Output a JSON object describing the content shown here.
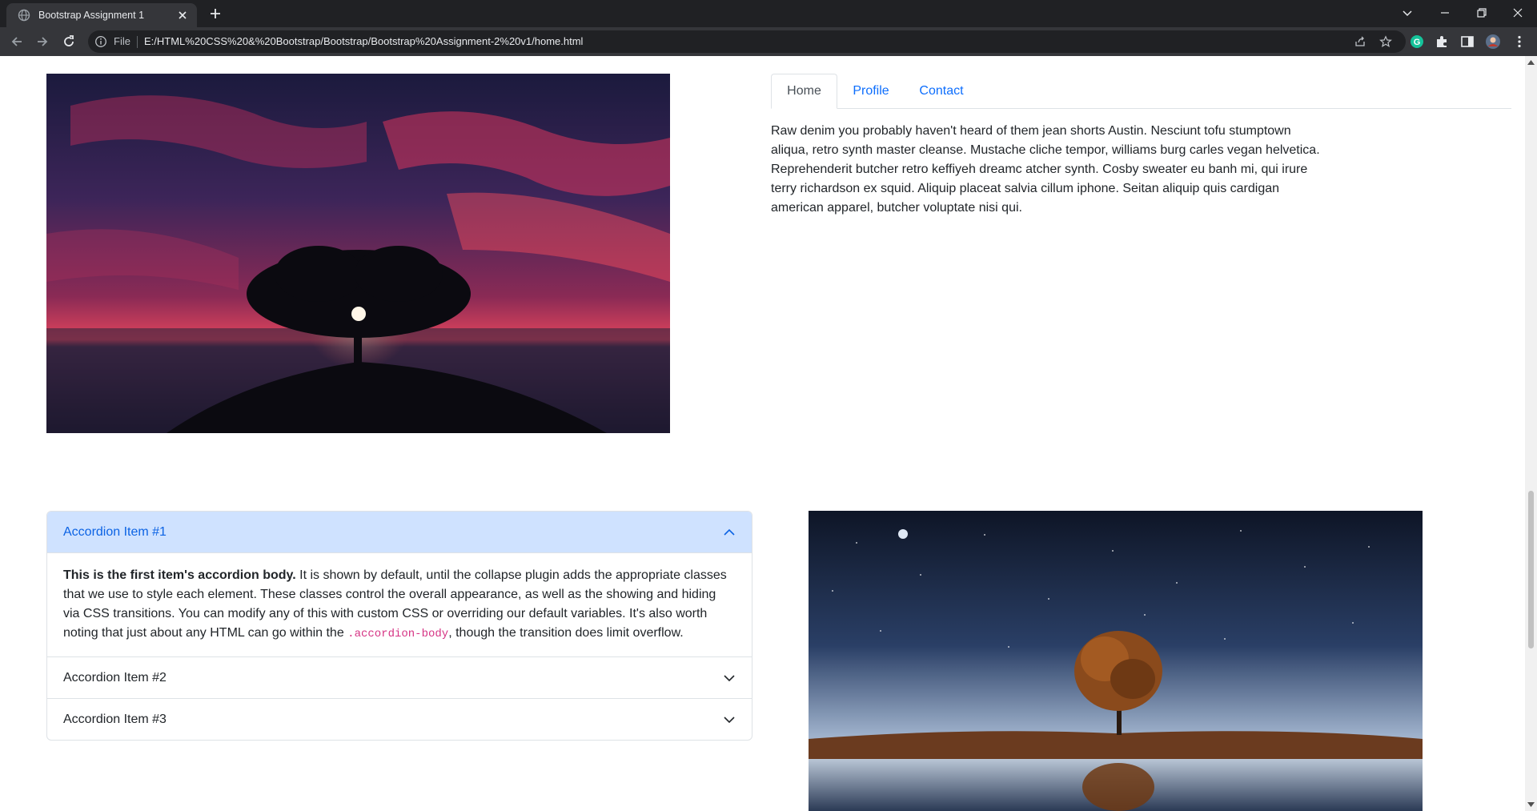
{
  "browser": {
    "tab_title": "Bootstrap Assignment 1",
    "url_scheme": "File",
    "url": "E:/HTML%20CSS%20&%20Bootstrap/Bootstrap/Bootstrap%20Assignment-2%20v1/home.html"
  },
  "tabs": {
    "items": [
      {
        "label": "Home",
        "active": true
      },
      {
        "label": "Profile",
        "active": false
      },
      {
        "label": "Contact",
        "active": false
      }
    ],
    "home_content": "Raw denim you probably haven't heard of them jean shorts Austin. Nesciunt tofu stumptown aliqua, retro synth master cleanse. Mustache cliche tempor, williams burg carles vegan helvetica. Reprehenderit butcher retro keffiyeh dreamc atcher synth. Cosby sweater eu banh mi, qui irure terry richardson ex squid. Aliquip placeat salvia cillum iphone. Seitan aliquip quis cardigan american apparel, butcher voluptate nisi qui."
  },
  "accordion": {
    "items": [
      {
        "title": "Accordion Item #1",
        "expanded": true
      },
      {
        "title": "Accordion Item #2",
        "expanded": false
      },
      {
        "title": "Accordion Item #3",
        "expanded": false
      }
    ],
    "body_strong": "This is the first item's accordion body.",
    "body_text_1": " It is shown by default, until the collapse plugin adds the appropriate classes that we use to style each element. These classes control the overall appearance, as well as the showing and hiding via CSS transitions. You can modify any of this with custom CSS or overriding our default variables. It's also worth noting that just about any HTML can go within the ",
    "body_code": ".accordion-body",
    "body_text_2": ", though the transition does limit overflow."
  },
  "images": {
    "top": "tree-sunset-photo",
    "bottom": "tree-night-lake-photo"
  },
  "colors": {
    "link": "#0d6efd",
    "accordion_active_bg": "#cfe2ff",
    "accordion_active_text": "#0c63e4"
  }
}
